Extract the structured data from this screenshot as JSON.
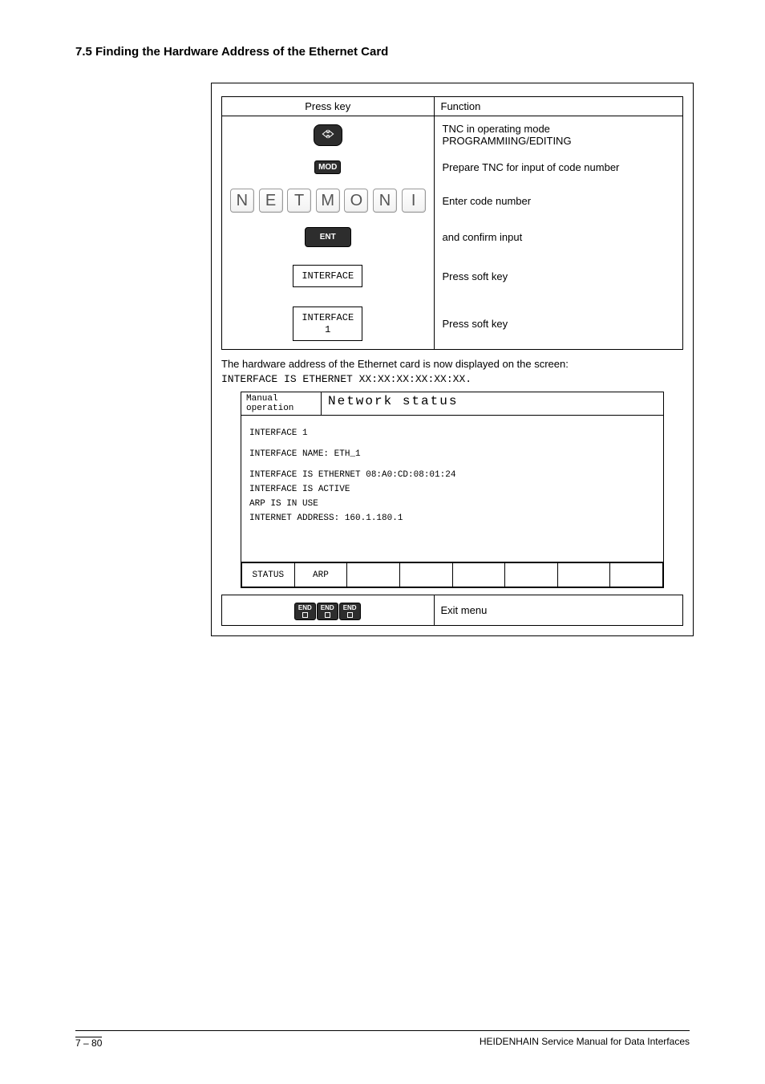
{
  "heading": "7.5 Finding the Hardware Address of the Ethernet Card",
  "table": {
    "head": {
      "col1": "Press key",
      "col2": "Function"
    },
    "rows": [
      {
        "fn": "TNC in operating mode PROGRAMMIING/EDITING"
      },
      {
        "btn": "MOD",
        "fn": "Prepare TNC for input of code number"
      },
      {
        "letters": [
          "N",
          "E",
          "T",
          "M",
          "O",
          "N",
          "I"
        ],
        "fn": "Enter code number"
      },
      {
        "btn": "ENT",
        "fn": "and confirm input"
      },
      {
        "soft": "INTERFACE",
        "fn": "Press soft key"
      },
      {
        "soft": "INTERFACE\n1",
        "fn": "Press soft key"
      }
    ]
  },
  "desc": "The hardware address of the Ethernet card is now displayed on the screen:",
  "code": "INTERFACE IS ETHERNET XX:XX:XX:XX:XX:XX.",
  "screen": {
    "mode": "Manual\noperation",
    "title": "Network status",
    "lines": [
      "INTERFACE 1",
      "INTERFACE NAME: ETH_1",
      "INTERFACE IS ETHERNET 08:A0:CD:08:01:24",
      "INTERFACE IS ACTIVE",
      "ARP IS IN USE",
      "INTERNET ADDRESS: 160.1.180.1"
    ],
    "fn": [
      "STATUS",
      "ARP",
      "",
      "",
      "",
      "",
      "",
      ""
    ]
  },
  "exit": {
    "label": "END",
    "fn": "Exit menu"
  },
  "footer": {
    "left": "7 – 80",
    "right": "HEIDENHAIN Service Manual for Data Interfaces"
  }
}
